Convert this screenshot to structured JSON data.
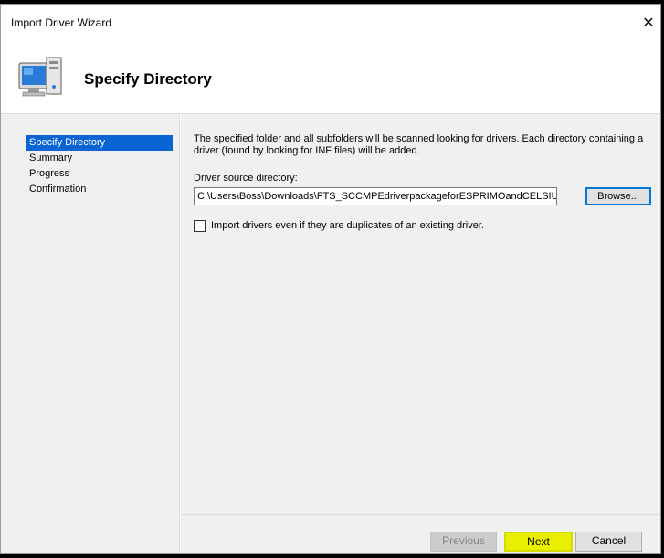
{
  "window": {
    "title": "Import Driver Wizard",
    "close_glyph": "✕"
  },
  "header": {
    "heading": "Specify Directory",
    "icon": "computer-icon"
  },
  "nav": {
    "items": [
      {
        "label": "Specify Directory",
        "active": true
      },
      {
        "label": "Summary",
        "active": false
      },
      {
        "label": "Progress",
        "active": false
      },
      {
        "label": "Confirmation",
        "active": false
      }
    ]
  },
  "content": {
    "description": "The specified folder and all subfolders will be scanned looking for drivers.  Each directory containing a driver (found by looking for INF files) will be added.",
    "source_label": "Driver source directory:",
    "source_value": "C:\\Users\\Boss\\Downloads\\FTS_SCCMPEdriverpackageforESPRIMOandCELSIUS",
    "browse_label": "Browse...",
    "duplicates_label": "Import drivers even if they are duplicates of an existing driver.",
    "duplicates_checked": false
  },
  "footer": {
    "previous_label": "Previous",
    "next_label": "Next",
    "cancel_label": "Cancel"
  },
  "colors": {
    "selection": "#0a64d4",
    "focus_border": "#0078d7",
    "highlight": "#e8ef00"
  }
}
